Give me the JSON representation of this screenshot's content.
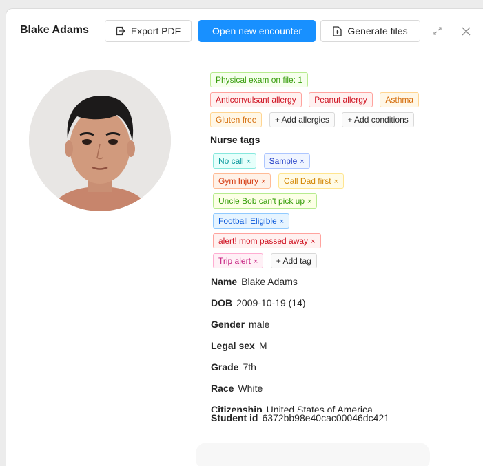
{
  "header": {
    "title": "Blake Adams",
    "export_label": "Export PDF",
    "open_label": "Open new encounter",
    "generate_label": "Generate files"
  },
  "status_tags": [
    {
      "label": "Physical exam on file: 1",
      "color": "green"
    },
    {
      "label": "Anticonvulsant allergy",
      "color": "red"
    },
    {
      "label": "Peanut allergy",
      "color": "red"
    },
    {
      "label": "Asthma",
      "color": "orange"
    },
    {
      "label": "Gluten free",
      "color": "orange"
    }
  ],
  "add_allergies_label": "+ Add allergies",
  "add_conditions_label": "+ Add conditions",
  "nurse_tags_title": "Nurse tags",
  "nurse_tags": [
    {
      "label": "No call",
      "color": "cyan"
    },
    {
      "label": "Sample",
      "color": "geekblue"
    },
    {
      "label": "Gym Injury",
      "color": "volcano"
    },
    {
      "label": "Call Dad first",
      "color": "gold"
    },
    {
      "label": "Uncle Bob can't pick up",
      "color": "lime"
    },
    {
      "label": "Football Eligible",
      "color": "blue"
    },
    {
      "label": "alert! mom passed away",
      "color": "red"
    },
    {
      "label": "Trip alert",
      "color": "magenta"
    }
  ],
  "add_tag_label": "+ Add tag",
  "fields": {
    "name": {
      "label": "Name",
      "value": "Blake Adams"
    },
    "dob": {
      "label": "DOB",
      "value": "2009-10-19 (14)"
    },
    "gender": {
      "label": "Gender",
      "value": "male"
    },
    "legal_sex": {
      "label": "Legal sex",
      "value": "M"
    },
    "grade": {
      "label": "Grade",
      "value": "7th"
    },
    "race": {
      "label": "Race",
      "value": "White"
    },
    "citizenship": {
      "label": "Citizenship",
      "value": "United States of America"
    },
    "student_id": {
      "label": "Student id",
      "value": "6372bb98e40cac00046dc421"
    }
  },
  "colors": {
    "primary": "#1890ff"
  },
  "icons": [
    "export-icon",
    "file-add-icon",
    "expand-icon",
    "close-icon"
  ]
}
